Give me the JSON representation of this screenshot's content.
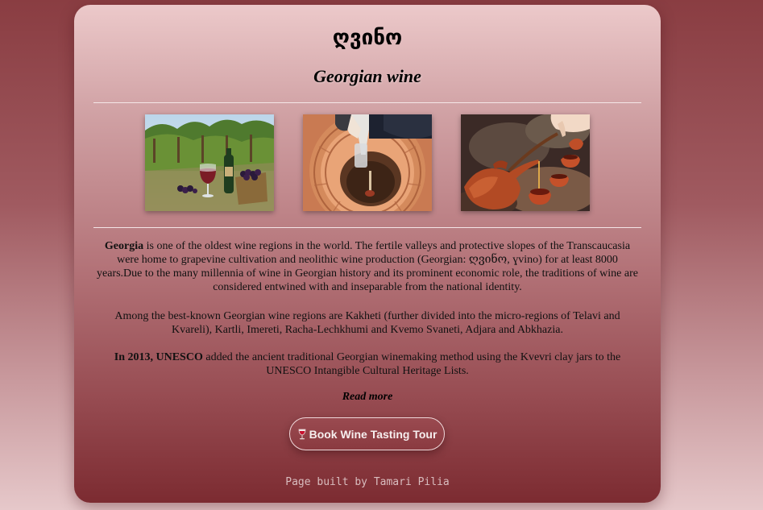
{
  "header": {
    "georgian_title": "ღვინო",
    "subtitle": "Georgian wine"
  },
  "gallery": [
    {
      "alt": "vineyard-with-wine-glass-and-grapes"
    },
    {
      "alt": "pouring-wine-from-qvevri"
    },
    {
      "alt": "clay-jug-pouring-wine-into-cups"
    }
  ],
  "content": {
    "p1_strong": "Georgia",
    "p1_text": " is one of the oldest wine regions in the world. The fertile valleys and protective slopes of the Transcaucasia were home to grapevine cultivation and neolithic wine production (Georgian: ღვინო, ɣvino) for at least 8000 years.Due to the many millennia of wine in Georgian history and its prominent economic role, the traditions of wine are considered entwined with and inseparable from the national identity.",
    "p2_text": "Among the best-known Georgian wine regions are Kakheti (further divided into the micro-regions of Telavi and Kvareli), Kartli, Imereti, Racha-Lechkhumi and Kvemo Svaneti, Adjara and Abkhazia.",
    "p3_strong": "In 2013, UNESCO",
    "p3_text": " added the ancient traditional Georgian winemaking method using the Kvevri clay jars to the UNESCO Intangible Cultural Heritage Lists."
  },
  "read_more_label": "Read more",
  "tour_button": {
    "icon": "wine-glass-icon",
    "label": "Book Wine Tasting Tour"
  },
  "footer": {
    "credit": "Page built by Tamari Pilia"
  },
  "colors": {
    "accent": "#8a3a40",
    "background_top": "#8a3d42",
    "card_top": "#ecc9ca",
    "card_bottom": "#7c2b31"
  }
}
